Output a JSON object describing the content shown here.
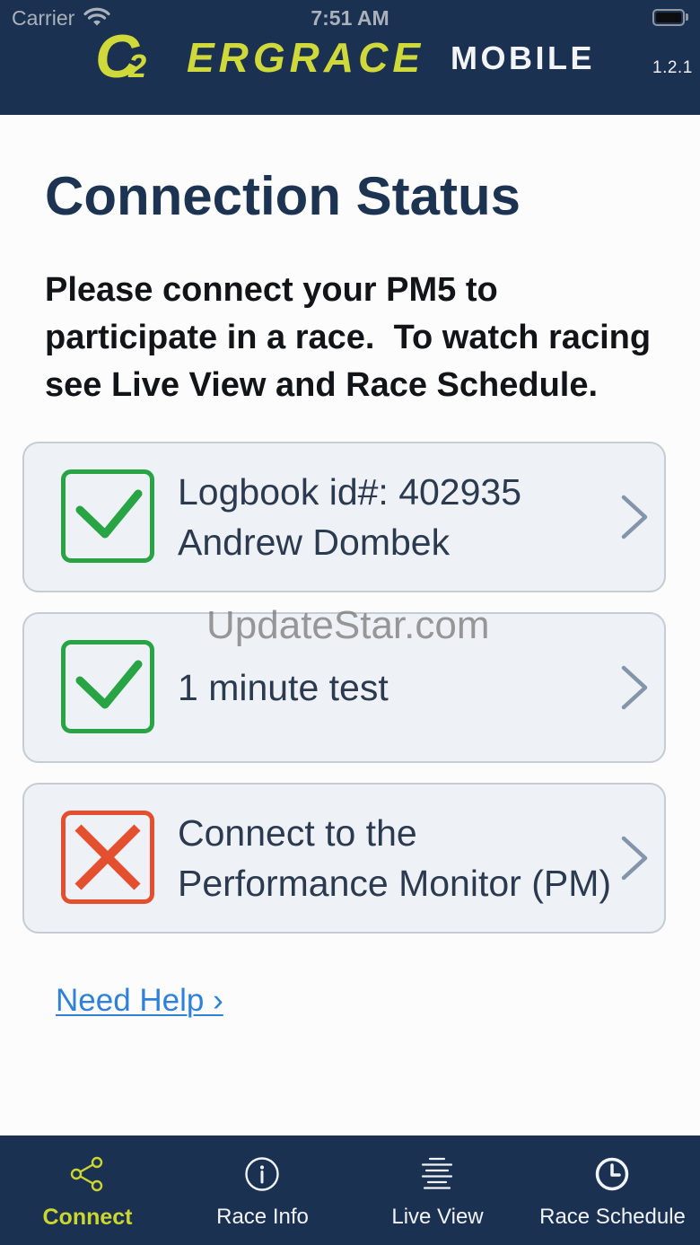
{
  "status_bar": {
    "carrier": "Carrier",
    "time": "7:51 AM",
    "wifi_icon": "wifi-icon",
    "battery_icon": "battery-icon",
    "battery_level": 1
  },
  "header": {
    "logo_mark": "C2",
    "brand_name": "ERGRACE",
    "brand_suffix": "MOBILE",
    "version": "1.2.1"
  },
  "page": {
    "title": "Connection Status",
    "instructions": "Please connect your PM5 to participate in a race.  To watch racing see Live View and Race Schedule."
  },
  "status_items": [
    {
      "icon": "check-icon",
      "chevron": "chevron-right-icon",
      "lines": [
        "Logbook id#: 402935",
        "Andrew Dombek"
      ]
    },
    {
      "icon": "check-icon",
      "chevron": "chevron-right-icon",
      "lines": [
        "1 minute test"
      ]
    },
    {
      "icon": "x-icon",
      "chevron": "chevron-right-icon",
      "lines": [
        "Connect to the",
        "Performance Monitor (PM)"
      ]
    }
  ],
  "watermark": "UpdateStar.com",
  "help_link": "Need Help ›",
  "tab_bar": {
    "tabs": [
      {
        "label": "Connect",
        "icon": "share-icon",
        "active": true
      },
      {
        "label": "Race Info",
        "icon": "info-icon",
        "active": false
      },
      {
        "label": "Live View",
        "icon": "live-view-icon",
        "active": false
      },
      {
        "label": "Race Schedule",
        "icon": "clock-icon",
        "active": false
      }
    ]
  },
  "colors": {
    "header_background": "#1b3152",
    "accent": "#cbd62f",
    "title": "#1d3352",
    "success": "#28a445",
    "error": "#e4502f",
    "link": "#2f80d8",
    "card_background": "#eef1f5"
  }
}
